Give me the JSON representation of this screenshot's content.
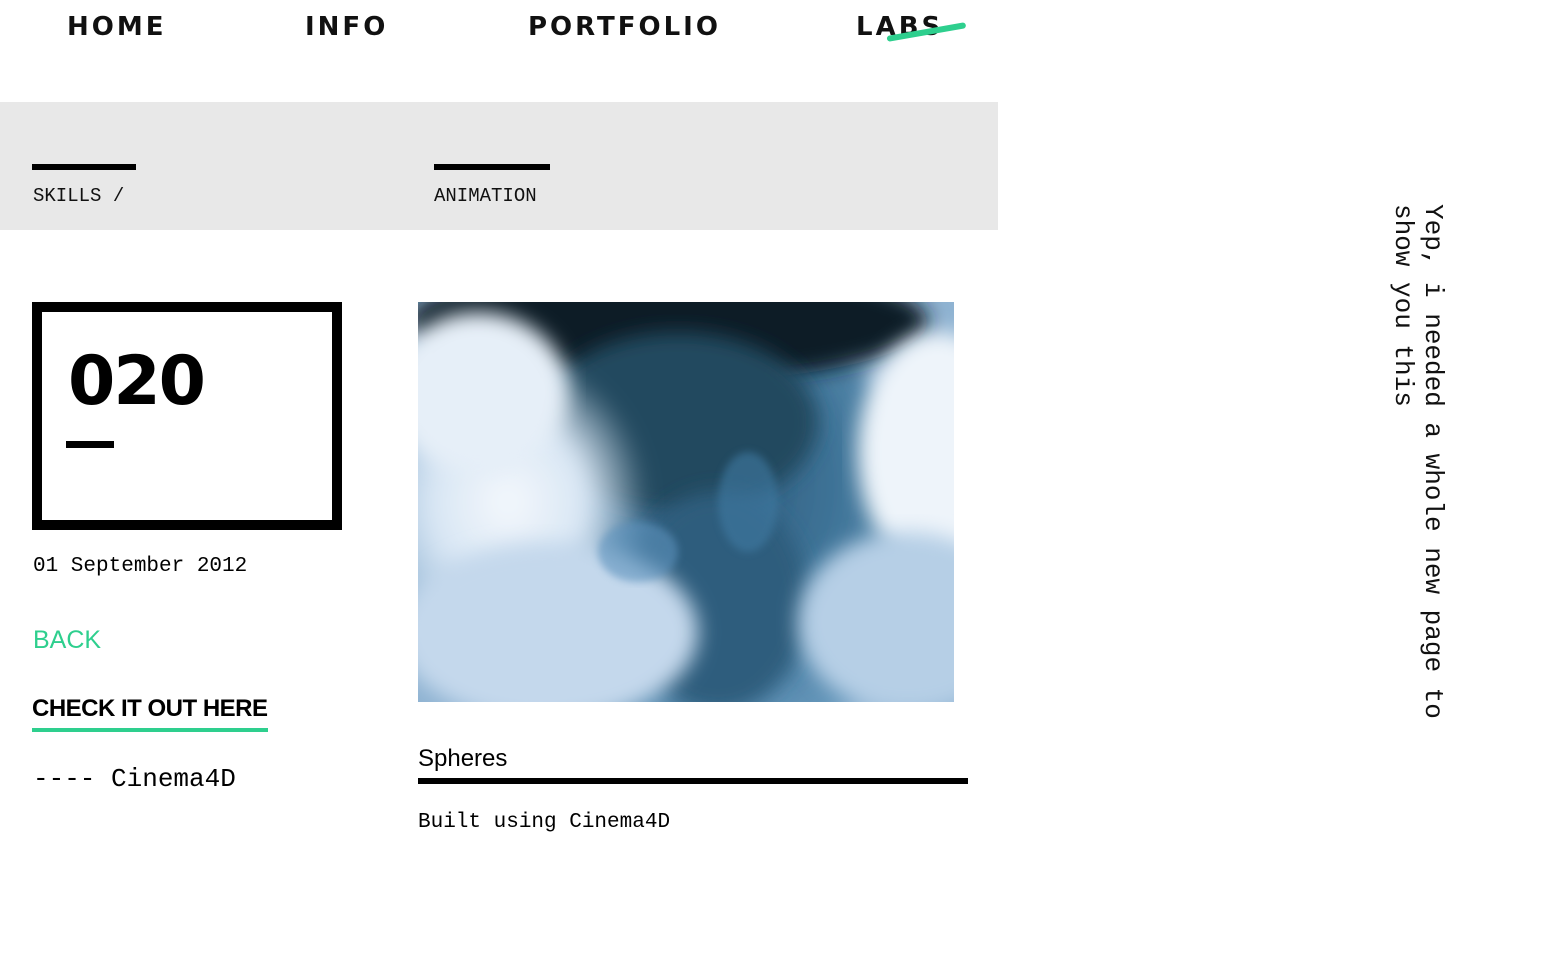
{
  "nav": {
    "items": [
      {
        "label": "HOME"
      },
      {
        "label": "INFO"
      },
      {
        "label": "PORTFOLIO"
      },
      {
        "label": "LABS",
        "active": true
      }
    ]
  },
  "skills": {
    "label": "SKILLS /",
    "category": "ANIMATION"
  },
  "project": {
    "number": "020",
    "date": "01 September 2012",
    "back_label": "BACK",
    "cta_label": "CHECK IT OUT HERE",
    "tools": "---- Cinema4D",
    "title": "Spheres",
    "description": "Built using Cinema4D",
    "image_icon": "smoke-render-image"
  },
  "side_note": "Yep, i needed a whole new page to show you this",
  "colors": {
    "accent": "#2ecf8e",
    "panel": "#e8e8e8",
    "text": "#000000"
  }
}
